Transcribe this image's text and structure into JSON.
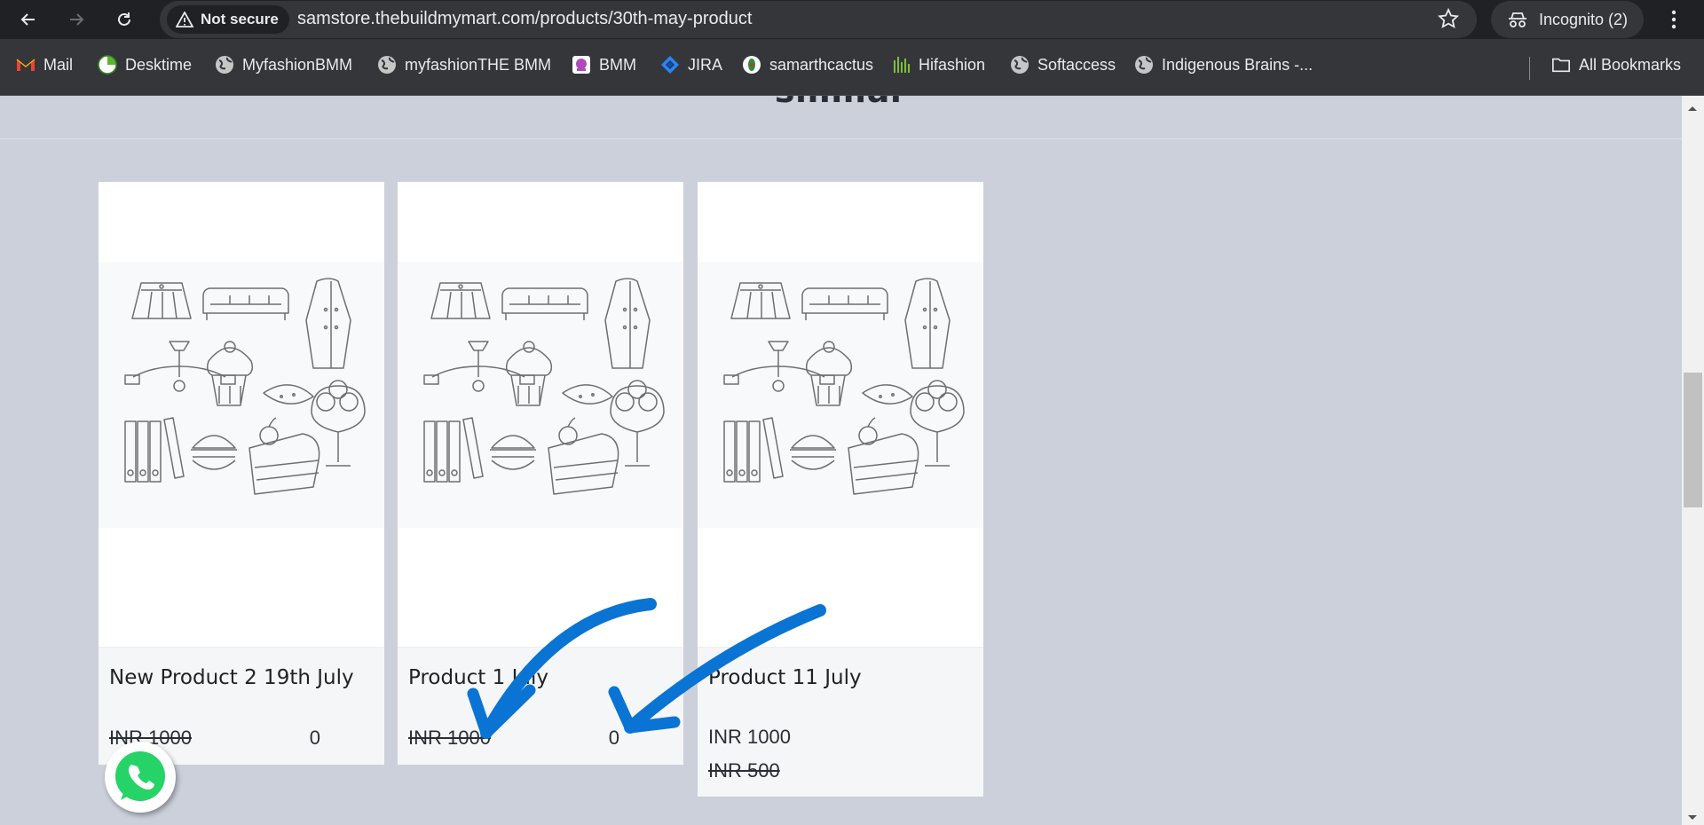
{
  "browser": {
    "security_label": "Not secure",
    "url": "samstore.thebuildmymart.com/products/30th-may-product",
    "incognito_label": "Incognito (2)",
    "accent": "#e8eaed"
  },
  "bookmarks": {
    "items": [
      {
        "label": "Mail",
        "icon": "gmail-icon"
      },
      {
        "label": "Desktime",
        "icon": "desktime-icon"
      },
      {
        "label": "MyfashionBMM",
        "icon": "globe-icon"
      },
      {
        "label": "myfashionTHE BMM",
        "icon": "globe-icon"
      },
      {
        "label": "BMM",
        "icon": "bmm-icon"
      },
      {
        "label": "JIRA",
        "icon": "jira-icon"
      },
      {
        "label": "samarthcactus",
        "icon": "cactus-icon"
      },
      {
        "label": "Hifashion",
        "icon": "hifashion-icon"
      },
      {
        "label": "Softaccess",
        "icon": "globe-icon"
      },
      {
        "label": "Indigenous Brains -...",
        "icon": "globe-icon"
      }
    ],
    "all_bookmarks": "All Bookmarks"
  },
  "section": {
    "heading": "similar"
  },
  "products": [
    {
      "title": "New Product 2 19th July",
      "price": "INR 1000",
      "qty": "0"
    },
    {
      "title": "Product 1 July",
      "price": "INR 1000",
      "qty": "0"
    },
    {
      "title": "Product 11 July",
      "price": "INR 1000",
      "old_price": "INR 500"
    }
  ],
  "colors": {
    "annotation": "#0a74d4",
    "whatsapp": "#25d366",
    "page_bg": "#cbd0da"
  }
}
